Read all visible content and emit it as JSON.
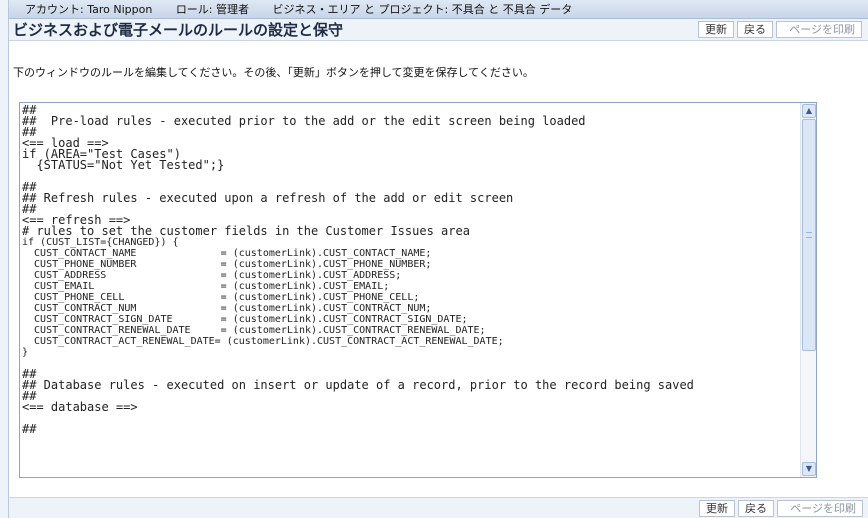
{
  "header": {
    "account": "アカウント: Taro Nippon",
    "role": "ロール: 管理者",
    "area": "ビジネス・エリア と プロジェクト: 不具合 と 不具合 データ"
  },
  "title": "ビジネスおよび電子メールのルールの設定と保守",
  "buttons": {
    "refresh": "更新",
    "back": "戻る",
    "print": "ページを印刷"
  },
  "instruction": "下のウィンドウのルールを編集してください。その後、「更新」ボタンを押して変更を保存してください。",
  "editor": {
    "lines": [
      "##",
      "##  Pre-load rules - executed prior to the add or the edit screen being loaded",
      "##",
      "<== load ==>",
      "if (AREA=\"Test Cases\")",
      "  {STATUS=\"Not Yet Tested\";}",
      "",
      "##",
      "## Refresh rules - executed upon a refresh of the add or edit screen",
      "##",
      "<== refresh ==>",
      "# rules to set the customer fields in the Customer Issues area",
      "if (CUST_LIST={CHANGED}) {",
      "  CUST_CONTACT_NAME              = (customerLink).CUST_CONTACT_NAME;",
      "  CUST_PHONE_NUMBER              = (customerLink).CUST_PHONE_NUMBER;",
      "  CUST_ADDRESS                   = (customerLink).CUST_ADDRESS;",
      "  CUST_EMAIL                     = (customerLink).CUST_EMAIL;",
      "  CUST_PHONE_CELL                = (customerLink).CUST_PHONE_CELL;",
      "  CUST_CONTRACT_NUM              = (customerLink).CUST_CONTRACT_NUM;",
      "  CUST_CONTRACT_SIGN_DATE        = (customerLink).CUST_CONTRACT_SIGN_DATE;",
      "  CUST_CONTRACT_RENEWAL_DATE     = (customerLink).CUST_CONTRACT_RENEWAL_DATE;",
      "  CUST_CONTRACT_ACT_RENEWAL_DATE= (customerLink).CUST_CONTRACT_ACT_RENEWAL_DATE;",
      "}",
      "",
      "##",
      "## Database rules - executed on insert or update of a record, prior to the record being saved",
      "##",
      "<== database ==>",
      "",
      "##"
    ]
  }
}
